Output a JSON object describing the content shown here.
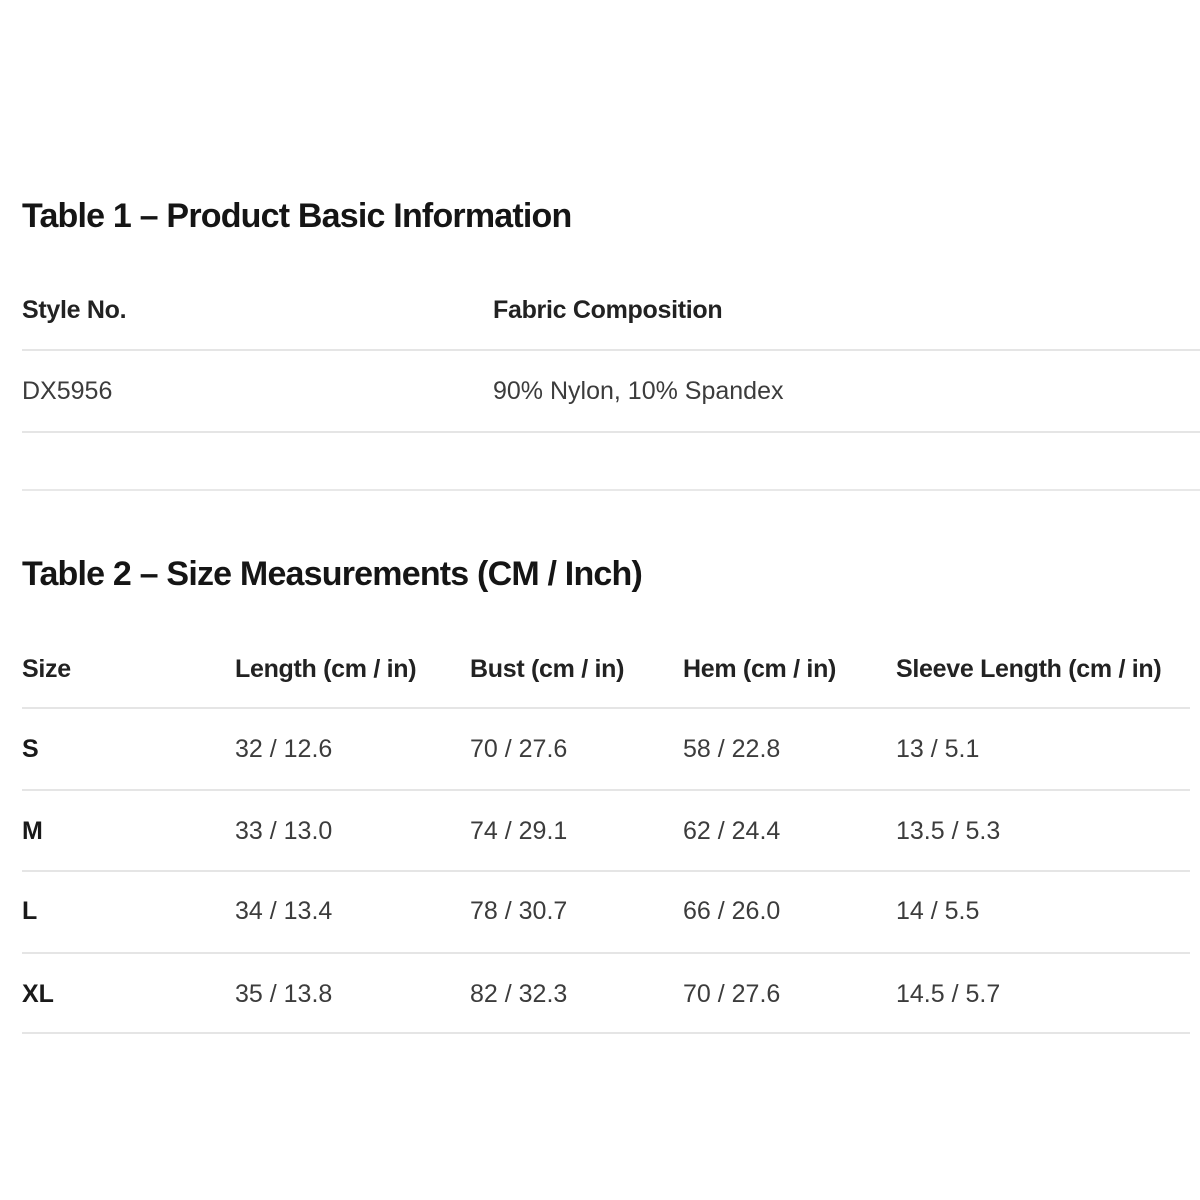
{
  "table1": {
    "title": "Table 1 – Product Basic Information",
    "headers": [
      "Style No.",
      "Fabric Composition"
    ],
    "rows": [
      [
        "DX5956",
        "90% Nylon, 10% Spandex"
      ]
    ]
  },
  "table2": {
    "title": "Table 2 – Size Measurements (CM / Inch)",
    "headers": [
      "Size",
      "Length (cm / in)",
      "Bust (cm / in)",
      "Hem (cm / in)",
      "Sleeve Length (cm / in)"
    ],
    "rows": [
      [
        "S",
        "32 / 12.6",
        "70 / 27.6",
        "58 / 22.8",
        "13 / 5.1"
      ],
      [
        "M",
        "33 / 13.0",
        "74 / 29.1",
        "62 / 24.4",
        "13.5 / 5.3"
      ],
      [
        "L",
        "34 / 13.4",
        "78 / 30.7",
        "66 / 26.0",
        "14 / 5.5"
      ],
      [
        "XL",
        "35 / 13.8",
        "82 / 32.3",
        "70 / 27.6",
        "14.5 / 5.7"
      ]
    ]
  }
}
